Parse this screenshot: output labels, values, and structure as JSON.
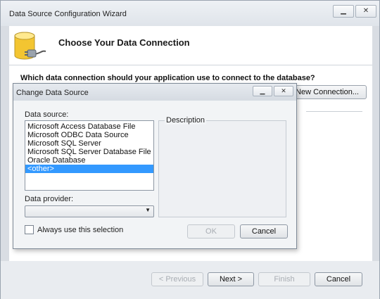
{
  "wizard": {
    "title": "Data Source Configuration Wizard",
    "window_controls": {
      "minimize": "▁",
      "close": "✕"
    },
    "heading": "Choose Your Data Connection",
    "question": "Which data connection should your application use to connect to the database?",
    "new_connection_label": "New Connection...",
    "footer": {
      "previous": "< Previous",
      "next": "Next >",
      "finish": "Finish",
      "cancel": "Cancel"
    }
  },
  "dialog": {
    "title": "Change Data Source",
    "window_controls": {
      "minimize": "▁",
      "close": "✕"
    },
    "data_source_label": "Data source:",
    "data_sources": [
      "Microsoft Access Database File",
      "Microsoft ODBC Data Source",
      "Microsoft SQL Server",
      "Microsoft SQL Server Database File",
      "Oracle Database",
      "<other>"
    ],
    "selected_index": 5,
    "description_label": "Description",
    "data_provider_label": "Data provider:",
    "data_provider_value": "",
    "always_use_label": "Always use this selection",
    "always_use_checked": false,
    "ok_label": "OK",
    "cancel_label": "Cancel"
  },
  "colors": {
    "selection": "#3399ff",
    "window_frame": "#d9dde3"
  }
}
